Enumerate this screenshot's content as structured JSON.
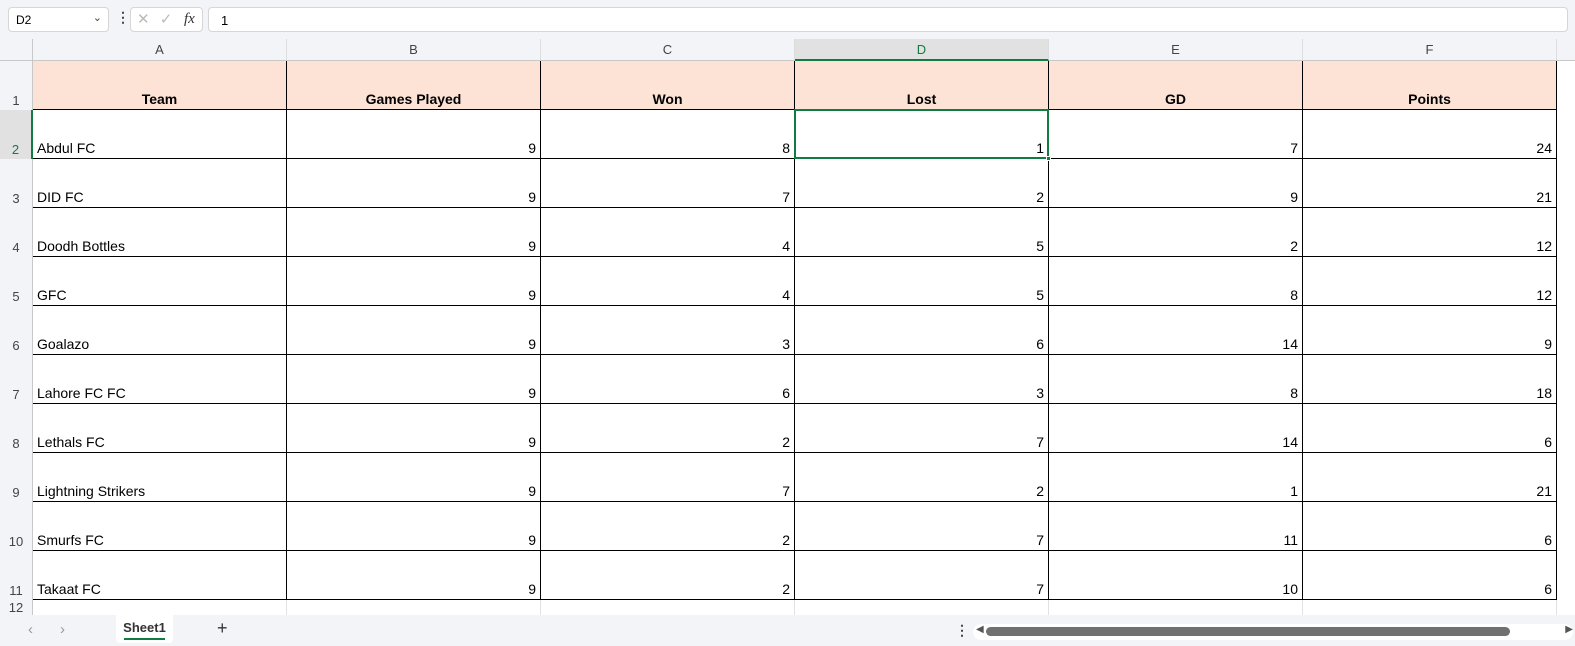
{
  "formula_bar": {
    "name_box": "D2",
    "formula": "1",
    "fx": "fx",
    "cancel": "✕",
    "enter": "✓"
  },
  "columns": [
    "A",
    "B",
    "C",
    "D",
    "E",
    "F"
  ],
  "selected_cell": {
    "col": "D",
    "row": 2
  },
  "header_fill": "#fde3d6",
  "accent": "#107c41",
  "headers": [
    "Team",
    "Games Played",
    "Won",
    "Lost",
    "GD",
    "Points"
  ],
  "rows": [
    [
      "Abdul FC",
      "9",
      "8",
      "1",
      "7",
      "24"
    ],
    [
      "DID FC",
      "9",
      "7",
      "2",
      "9",
      "21"
    ],
    [
      "Doodh Bottles",
      "9",
      "4",
      "5",
      "2",
      "12"
    ],
    [
      "GFC",
      "9",
      "4",
      "5",
      "8",
      "12"
    ],
    [
      "Goalazo",
      "9",
      "3",
      "6",
      "14",
      "9"
    ],
    [
      "Lahore FC FC",
      "9",
      "6",
      "3",
      "8",
      "18"
    ],
    [
      "Lethals FC",
      "9",
      "2",
      "7",
      "14",
      "6"
    ],
    [
      "Lightning Strikers",
      "9",
      "7",
      "2",
      "1",
      "21"
    ],
    [
      "Smurfs FC",
      "9",
      "2",
      "7",
      "11",
      "6"
    ],
    [
      "Takaat FC",
      "9",
      "2",
      "7",
      "10",
      "6"
    ]
  ],
  "row_numbers": [
    "1",
    "2",
    "3",
    "4",
    "5",
    "6",
    "7",
    "8",
    "9",
    "10",
    "11",
    "12"
  ],
  "sheet_tabs": [
    {
      "label": "Sheet1",
      "active": true
    }
  ],
  "add_sheet": "+"
}
